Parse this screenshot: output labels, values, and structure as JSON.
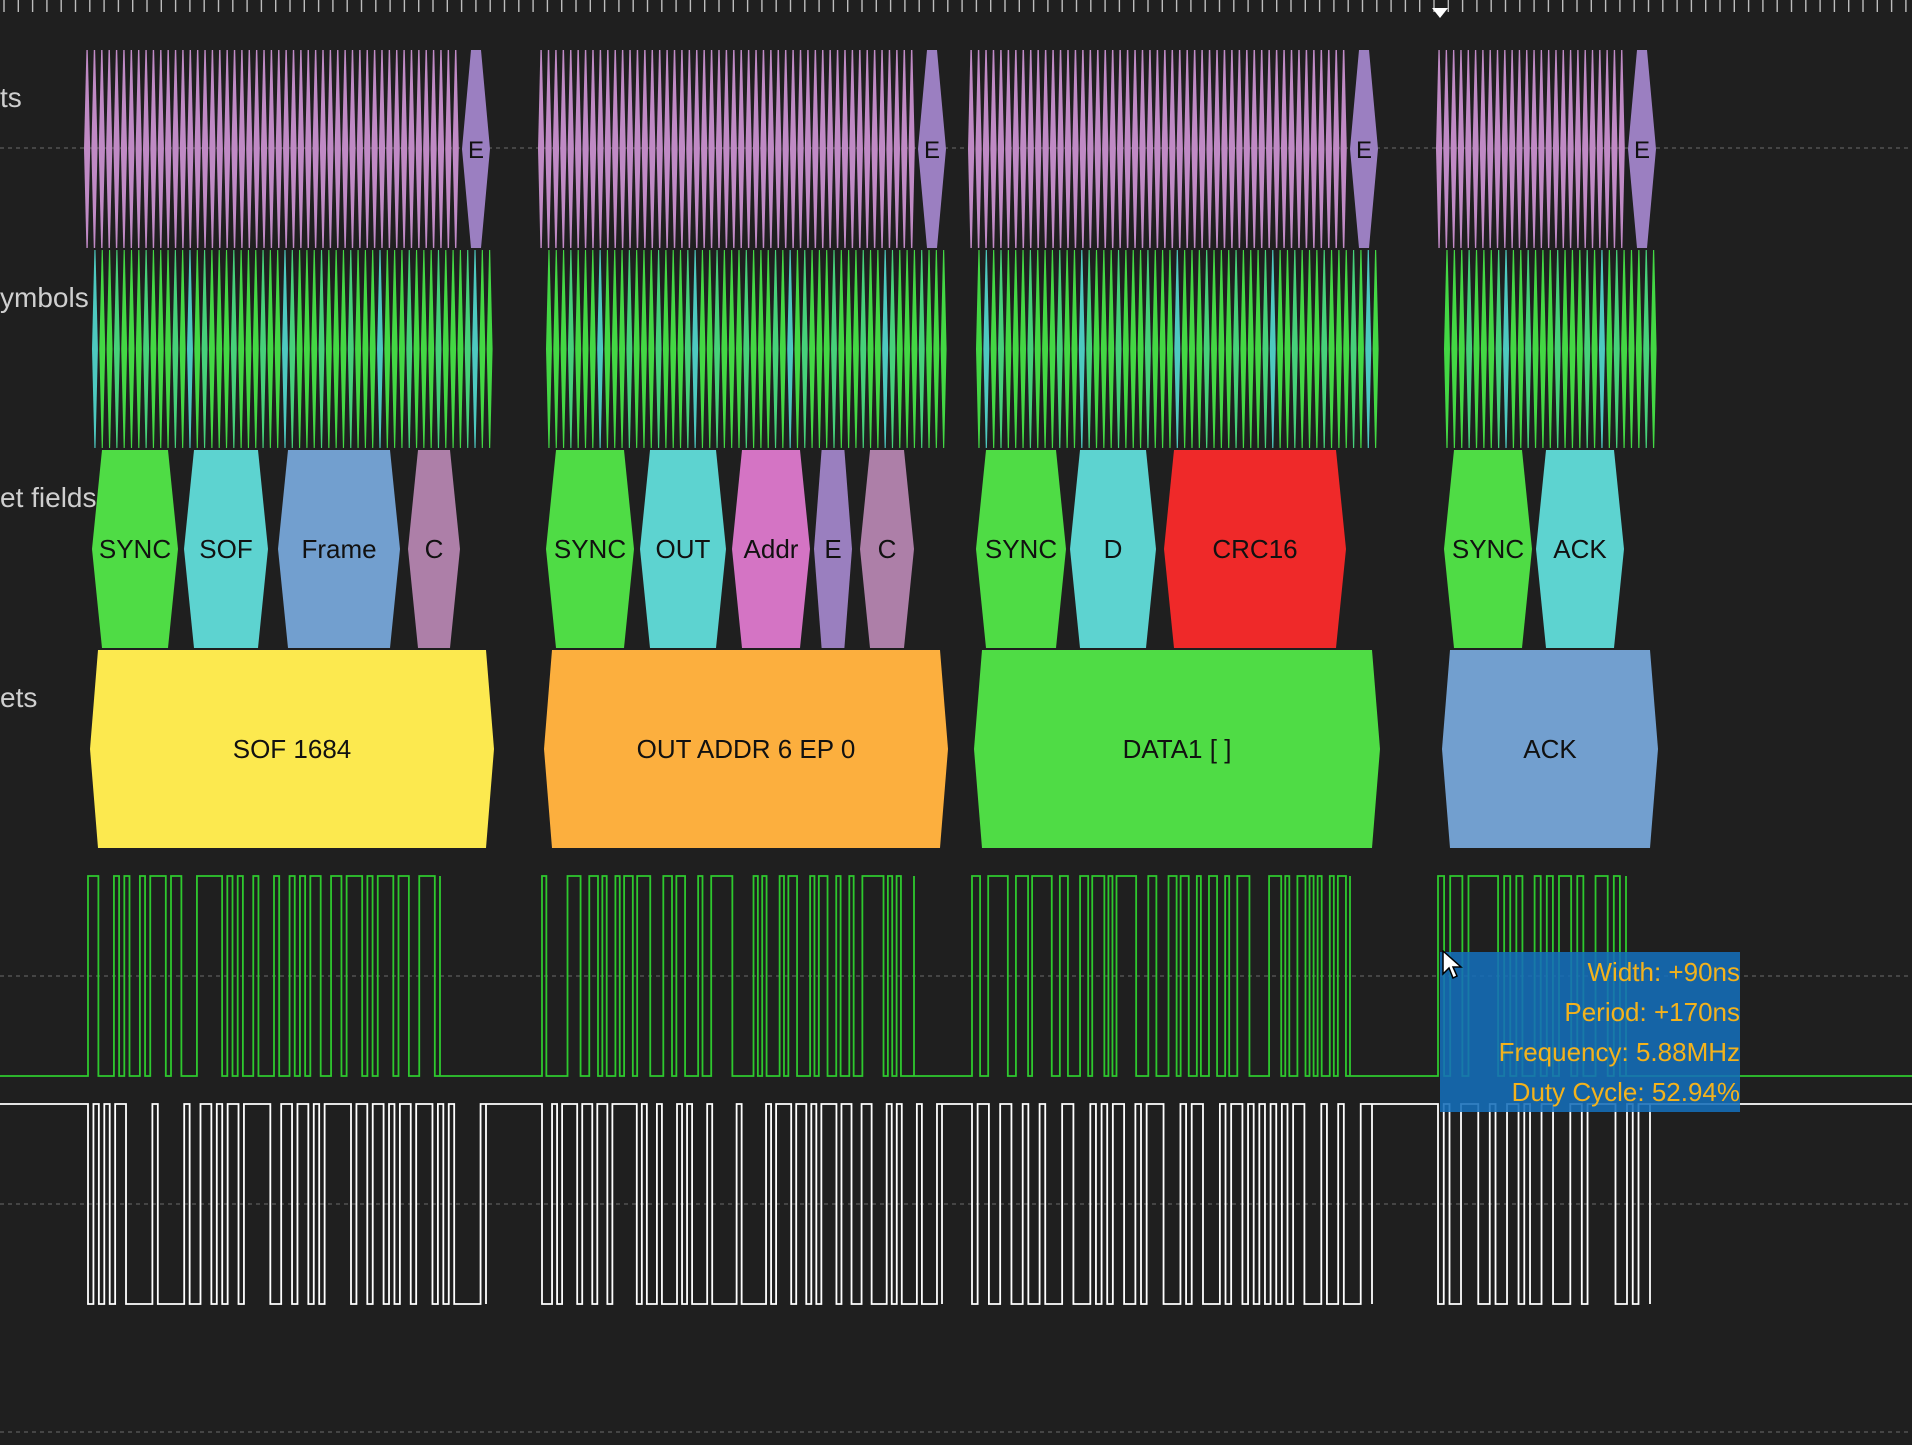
{
  "rows": [
    "ts",
    "ymbols",
    "et fields",
    "ets"
  ],
  "colors": {
    "background": "#1f1f1f",
    "gridline": "#6b6b6b",
    "signal_dp": "#2ec92e",
    "signal_dm": "#ffffff",
    "tooltip_bg": "#1a70b8",
    "tooltip_text": "#f3b21c"
  },
  "groups": [
    {
      "bits_end_label": "E",
      "fields": [
        {
          "label": "SYNC",
          "color": "#4fdc45"
        },
        {
          "label": "SOF",
          "color": "#5dd3d0"
        },
        {
          "label": "Frame",
          "color": "#729fcf"
        },
        {
          "label": "C",
          "color": "#ad7fa8"
        }
      ],
      "packet": {
        "label": "SOF 1684",
        "color": "#fce94f"
      }
    },
    {
      "bits_end_label": "E",
      "fields": [
        {
          "label": "SYNC",
          "color": "#4fdc45"
        },
        {
          "label": "OUT",
          "color": "#5dd3d0"
        },
        {
          "label": "Addr",
          "color": "#d474c4"
        },
        {
          "label": "E",
          "color": "#9a7fbf"
        },
        {
          "label": "C",
          "color": "#ad7fa8"
        }
      ],
      "packet": {
        "label": "OUT ADDR 6 EP 0",
        "color": "#fcaf3e"
      }
    },
    {
      "bits_end_label": "E",
      "fields": [
        {
          "label": "SYNC",
          "color": "#4fdc45"
        },
        {
          "label": "D",
          "color": "#5dd3d0"
        },
        {
          "label": "CRC16",
          "color": "#ef2929"
        }
      ],
      "packet": {
        "label": "DATA1 [ ]",
        "color": "#4fdc45"
      }
    },
    {
      "bits_end_label": "E",
      "fields": [
        {
          "label": "SYNC",
          "color": "#4fdc45"
        },
        {
          "label": "ACK",
          "color": "#5dd3d0"
        }
      ],
      "packet": {
        "label": "ACK",
        "color": "#729fcf"
      }
    }
  ],
  "tooltip": {
    "width": "Width: +90ns",
    "period": "Period: +170ns",
    "frequency": "Frequency: 5.88MHz",
    "duty_cycle": "Duty Cycle: 52.94%"
  }
}
